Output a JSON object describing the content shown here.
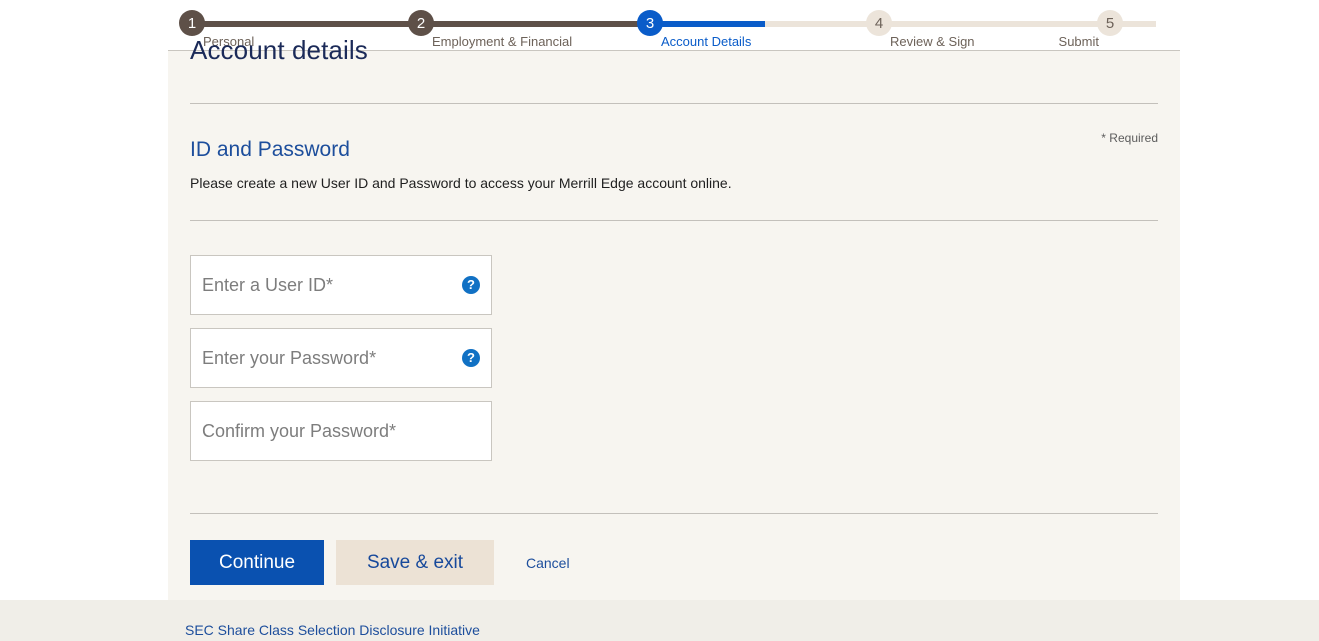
{
  "stepper": {
    "steps": [
      {
        "number": "1",
        "label": "Personal",
        "state": "done"
      },
      {
        "number": "2",
        "label": "Employment & Financial",
        "state": "done"
      },
      {
        "number": "3",
        "label": "Account Details",
        "state": "active"
      },
      {
        "number": "4",
        "label": "Review & Sign",
        "state": "todo"
      },
      {
        "number": "5",
        "label": "Submit",
        "state": "todo"
      }
    ],
    "colors": {
      "done": "#5e5048",
      "active": "#0a5cc9",
      "todo": "#ece4da"
    }
  },
  "page": {
    "title": "Account details",
    "required_note": "* Required"
  },
  "section": {
    "title": "ID and Password",
    "description": "Please create a new User ID and Password to access your Merrill Edge account online."
  },
  "fields": [
    {
      "name": "user-id",
      "placeholder": "Enter a User ID*",
      "value": "",
      "has_help": true,
      "help_icon": "question-mark-icon"
    },
    {
      "name": "password",
      "placeholder": "Enter your Password*",
      "value": "",
      "has_help": true,
      "help_icon": "question-mark-icon"
    },
    {
      "name": "confirm-password",
      "placeholder": "Confirm your Password*",
      "value": "",
      "has_help": false,
      "help_icon": ""
    }
  ],
  "actions": {
    "continue_label": "Continue",
    "save_exit_label": "Save & exit",
    "cancel_label": "Cancel"
  },
  "footer": {
    "link_label": "SEC Share Class Selection Disclosure Initiative"
  }
}
